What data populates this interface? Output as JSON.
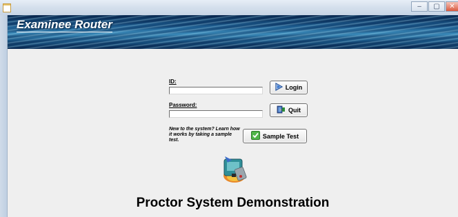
{
  "window": {
    "minimize_label": "–",
    "maximize_label": "▢",
    "close_label": "✕"
  },
  "banner": {
    "title": "Examinee Router"
  },
  "form": {
    "id_label": "ID:",
    "id_value": "",
    "password_label": "Password:",
    "password_value": "",
    "login_label": "Login",
    "quit_label": "Quit",
    "sample_note": "New to the system?  Learn how it works by taking a sample test.",
    "sample_test_label": "Sample Test"
  },
  "footer": {
    "title": "Proctor System Demonstration"
  },
  "icons": {
    "login": "arrow-right-icon",
    "quit": "exit-door-icon",
    "sample_test": "checkmark-icon",
    "logo": "proctor-logo-icon"
  }
}
